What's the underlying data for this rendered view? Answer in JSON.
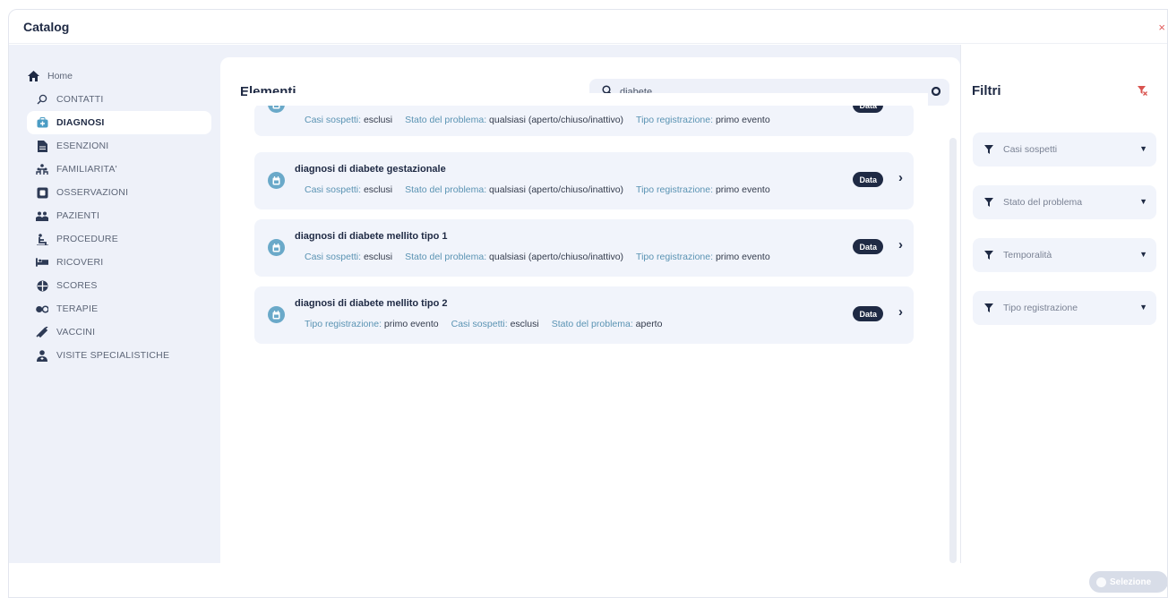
{
  "window": {
    "title": "Catalog",
    "close_label": "×"
  },
  "sidebar": {
    "home_label": "Home",
    "items": [
      {
        "label": "CONTATTI",
        "icon": "search-icon",
        "active": false
      },
      {
        "label": "DIAGNOSI",
        "icon": "diagnosis-icon",
        "active": true
      },
      {
        "label": "ESENZIONI",
        "icon": "document-icon",
        "active": false
      },
      {
        "label": "FAMILIARITA'",
        "icon": "family-icon",
        "active": false
      },
      {
        "label": "OSSERVAZIONI",
        "icon": "observation-icon",
        "active": false
      },
      {
        "label": "PAZIENTI",
        "icon": "patients-icon",
        "active": false
      },
      {
        "label": "PROCEDURE",
        "icon": "procedure-icon",
        "active": false
      },
      {
        "label": "RICOVERI",
        "icon": "bed-icon",
        "active": false
      },
      {
        "label": "SCORES",
        "icon": "scores-icon",
        "active": false
      },
      {
        "label": "TERAPIE",
        "icon": "pills-icon",
        "active": false
      },
      {
        "label": "VACCINI",
        "icon": "syringe-icon",
        "active": false
      },
      {
        "label": "VISITE SPECIALISTICHE",
        "icon": "doctor-icon",
        "active": false
      }
    ]
  },
  "main": {
    "title": "Elementi",
    "search": {
      "value": "diabete"
    },
    "cards": [
      {
        "title": "",
        "clipped": true,
        "meta": [
          {
            "key": "Casi sospetti",
            "value": "esclusi"
          },
          {
            "key": "Stato del problema",
            "value": "qualsiasi (aperto/chiuso/inattivo)"
          },
          {
            "key": "Tipo registrazione",
            "value": "primo evento"
          }
        ],
        "badge": "Data"
      },
      {
        "title": "diagnosi di diabete gestazionale",
        "meta": [
          {
            "key": "Casi sospetti",
            "value": "esclusi"
          },
          {
            "key": "Stato del problema",
            "value": "qualsiasi (aperto/chiuso/inattivo)"
          },
          {
            "key": "Tipo registrazione",
            "value": "primo evento"
          }
        ],
        "badge": "Data"
      },
      {
        "title": "diagnosi di diabete mellito tipo 1",
        "meta": [
          {
            "key": "Casi sospetti",
            "value": "esclusi"
          },
          {
            "key": "Stato del problema",
            "value": "qualsiasi (aperto/chiuso/inattivo)"
          },
          {
            "key": "Tipo registrazione",
            "value": "primo evento"
          }
        ],
        "badge": "Data"
      },
      {
        "title": "diagnosi di diabete mellito tipo 2",
        "meta": [
          {
            "key": "Tipo registrazione",
            "value": "primo evento"
          },
          {
            "key": "Casi sospetti",
            "value": "esclusi"
          },
          {
            "key": "Stato del problema",
            "value": "aperto"
          }
        ],
        "badge": "Data"
      }
    ]
  },
  "filters": {
    "title": "Filtri",
    "items": [
      "Casi sospetti",
      "Stato del problema",
      "Temporalità",
      "Tipo registrazione"
    ]
  },
  "footer": {
    "select_label": "Selezione"
  },
  "colors": {
    "accent": "#5a93b3",
    "dark": "#1f2a44",
    "panel": "#eef1f9",
    "danger": "#d9534f"
  }
}
